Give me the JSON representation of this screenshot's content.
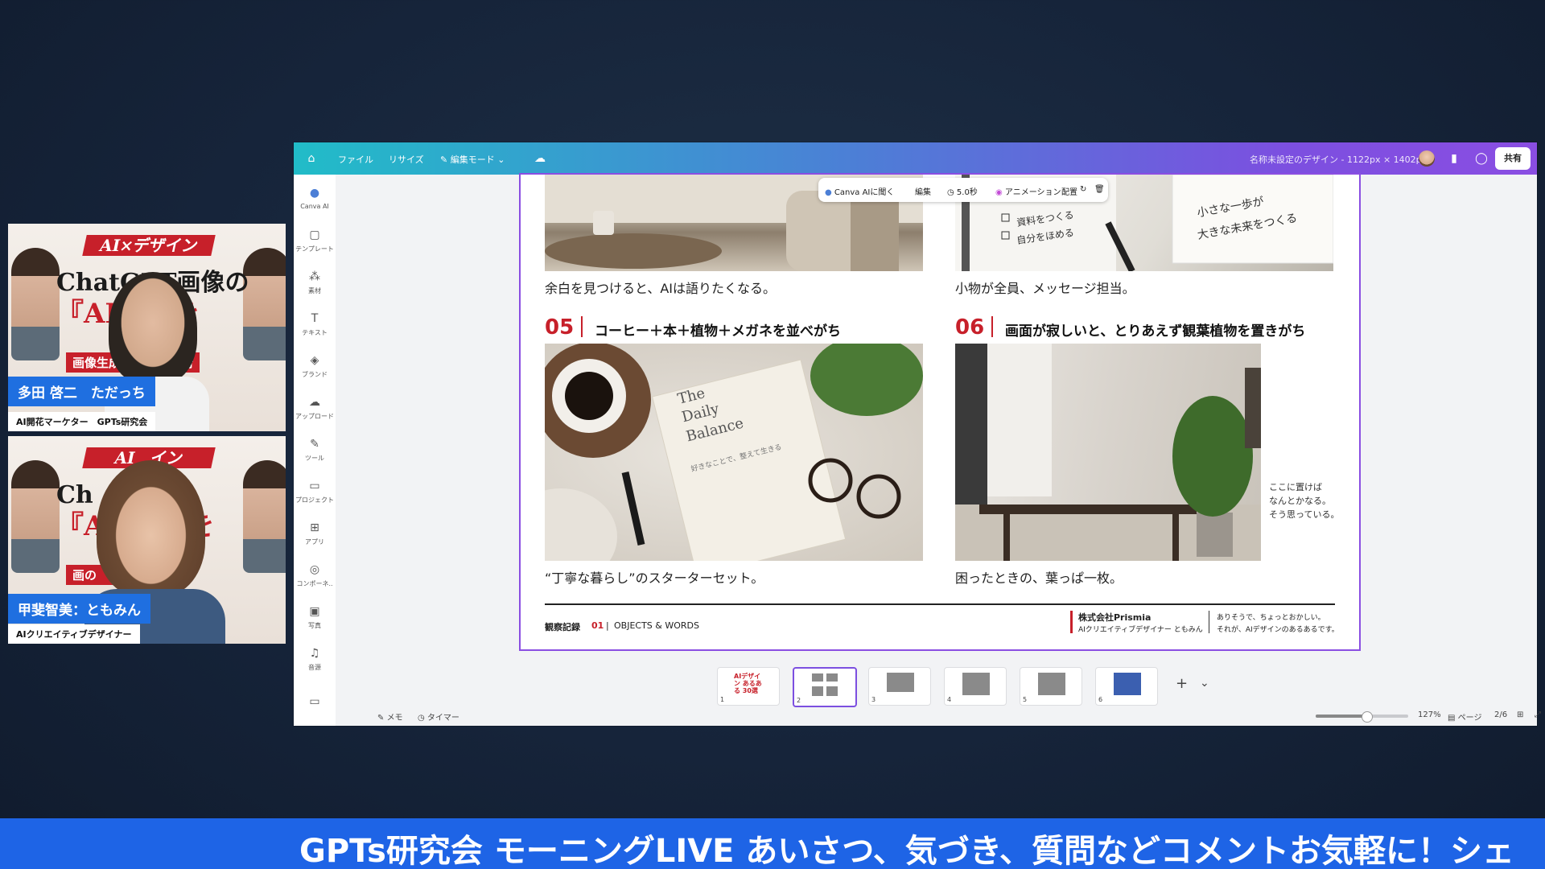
{
  "participants": [
    {
      "name": "多田 啓二　ただっち",
      "role": "AI開花マーケター　GPTs研究会",
      "thumb_banner": "AI×デザイン",
      "thumb_line1": "ChatGPT画像の",
      "thumb_line2": "『AI　』を",
      "thumb_tag": "画像生成の　ト改善術"
    },
    {
      "name": "甲斐智美：ともみん",
      "role": "AIクリエイティブデザイナー",
      "thumb_banner": "AI　イン",
      "thumb_line1": "Ch　　像の",
      "thumb_line2": "『A　　』を",
      "thumb_tag": "画の　　改善術"
    }
  ],
  "canva": {
    "topbar": {
      "home_icon": "home-icon",
      "file": "ファイル",
      "resize": "リサイズ",
      "edit_mode": "編集モード",
      "design_title": "名称未設定のデザイン - 1122px × 1402px",
      "share": "共有"
    },
    "sidebar": [
      {
        "icon": "canva-ai-icon",
        "glyph": "●",
        "label": "Canva AI"
      },
      {
        "icon": "template-icon",
        "glyph": "▢",
        "label": "テンプレート"
      },
      {
        "icon": "elements-icon",
        "glyph": "⁂",
        "label": "素材"
      },
      {
        "icon": "text-icon",
        "glyph": "T",
        "label": "テキスト"
      },
      {
        "icon": "brand-icon",
        "glyph": "◈",
        "label": "ブランド"
      },
      {
        "icon": "upload-icon",
        "glyph": "☁",
        "label": "アップロード"
      },
      {
        "icon": "tools-icon",
        "glyph": "✎",
        "label": "ツール"
      },
      {
        "icon": "projects-icon",
        "glyph": "▭",
        "label": "プロジェクト"
      },
      {
        "icon": "apps-icon",
        "glyph": "⊞",
        "label": "アプリ"
      },
      {
        "icon": "components-icon",
        "glyph": "◎",
        "label": "コンポーネ.."
      },
      {
        "icon": "photos-icon",
        "glyph": "▣",
        "label": "写真"
      },
      {
        "icon": "audio-icon",
        "glyph": "♫",
        "label": "音源"
      }
    ],
    "context_toolbar": {
      "ask_ai": "Canva AIに聞く",
      "edit": "編集",
      "duration": "5.0秒",
      "animation": "アニメーション",
      "arrange": "配置"
    },
    "page": {
      "caption_a": "余白を見つけると、AIは語りたくなる。",
      "caption_b": "小物が全員、メッセージ担当。",
      "note_b_1": "小さな一歩が",
      "note_b_2": "大きな未来をつくる",
      "list_b_1": "資料をつくる",
      "list_b_2": "自分をほめる",
      "num_05": "05",
      "head_05": "コーヒー＋本＋植物＋メガネを並べがち",
      "num_06": "06",
      "head_06": "画面が寂しいと、とりあえず観葉植物を置きがち",
      "book_title_1": "The",
      "book_title_2": "Daily",
      "book_title_3": "Balance",
      "book_sub": "好きなことで、整えて生きる",
      "caption_c": "“丁寧な暮らし”のスターターセット。",
      "caption_d": "困ったときの、葉っぱ一枚。",
      "side_note_1": "ここに置けば",
      "side_note_2": "なんとかなる。",
      "side_note_3": "そう思っている。",
      "footer_label": "観察記録",
      "footer_num": "01",
      "footer_sep": "|",
      "footer_words": "OBJECTS & WORDS",
      "company": "株式会社Prismia",
      "company_sub": "AIクリエイティブデザイナー ともみん",
      "tagline_1": "ありそうで、ちょっとおかしい。",
      "tagline_2": "それが、AIデザインのあるあるです。"
    },
    "thumbnails": [
      {
        "n": "1",
        "title": "AIデザイン あるある 30選"
      },
      {
        "n": "2",
        "selected": true
      },
      {
        "n": "3"
      },
      {
        "n": "4"
      },
      {
        "n": "5"
      },
      {
        "n": "6"
      }
    ],
    "bottom": {
      "notes": "メモ",
      "timer": "タイマー",
      "zoom": "127%",
      "zoom_fraction": 0.55,
      "pages_label": "ページ",
      "page_count": "2/6"
    }
  },
  "ticker": {
    "text": "GPTs研究会 モーニングLIVE あいさつ、気づき、質問などコメントお気軽に！シェ"
  },
  "colors": {
    "accent_red": "#c7202a",
    "nametag_blue": "#1f6fe0",
    "ticker_blue": "#1e64e6",
    "canva_purple": "#7c4fe0",
    "canva_teal": "#21bcc8"
  }
}
